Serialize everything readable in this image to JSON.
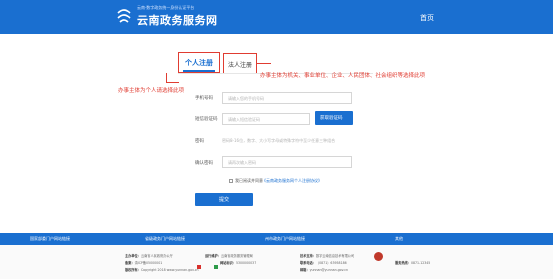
{
  "header": {
    "small_text": "云南·数字政务统一身份认证平台",
    "site_title": "云南政务服务网",
    "home_link": "首页"
  },
  "tabs": {
    "personal": "个人注册",
    "legal": "法人注册"
  },
  "annotations": {
    "legal_note": "办事主体为机关、事业单位、企业、人民团体、社会组织等选择此项",
    "personal_note": "办事主体为个人请选择此项"
  },
  "form": {
    "phone_label": "手机号码",
    "phone_placeholder": "请输入您的手机号码",
    "code_label": "短信验证码",
    "code_placeholder": "请输入短信验证码",
    "code_button": "获取验证码",
    "password_label": "密码",
    "password_hint": "密码8-16位，数字、大小写字母或特殊字符中至少任意三种组合",
    "confirm_label": "确认密码",
    "confirm_placeholder": "请再次输入密码",
    "agree_text": "我已阅读并同意",
    "agree_link": "《云南政务服务网个人注册协议》",
    "submit": "提交"
  },
  "link_bar": {
    "items": [
      "国家部委门户网站链接",
      "省级政务门户网站链接",
      "州市政务门户网站链接",
      "其他"
    ]
  },
  "footer": {
    "sponsor_key": "主办单位：",
    "sponsor_val": "云南省人民政府办公厅",
    "operator_key": "运行维护：",
    "operator_val": "云南省政务服务管理局",
    "support_key": "技术支持：",
    "support_val": "数字云南信息技术有限公司",
    "service_key": "服务热线：",
    "service_val": "0871-12345",
    "record_key": "备案：",
    "record_val": "滇ICP备05000001",
    "site_id_key": "网站标识：",
    "site_id_val": "5300000037",
    "phone_key": "联系电话：",
    "phone_val": "（0871）63958186",
    "email_key": "邮箱：",
    "email_val": "yunnan@yunnan.gov.cn",
    "copyright_key": "版权所有：",
    "copyright_val": "Copyright 2018 www.yunnan.gov.cn"
  },
  "colors": {
    "brand_blue": "#1a6fd0",
    "annotation_red": "#e03c31"
  }
}
